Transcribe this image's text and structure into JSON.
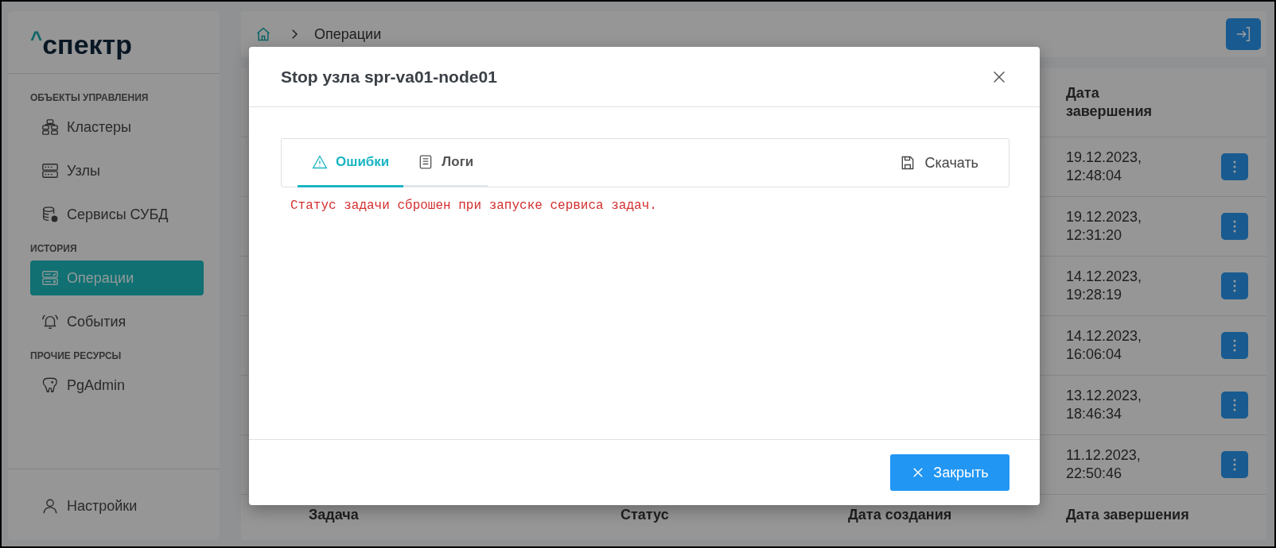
{
  "sidebar": {
    "logo": {
      "mark": "^",
      "name": "спектр"
    },
    "sections": [
      {
        "title": "ОБЪЕКТЫ УПРАВЛЕНИЯ",
        "items": [
          {
            "label": "Кластеры",
            "selected": false
          },
          {
            "label": "Узлы",
            "selected": false
          },
          {
            "label": "Сервисы СУБД",
            "selected": false
          }
        ]
      },
      {
        "title": "ИСТОРИЯ",
        "items": [
          {
            "label": "Операции",
            "selected": true
          },
          {
            "label": "События",
            "selected": false
          }
        ]
      },
      {
        "title": "ПРОЧИЕ РЕСУРСЫ",
        "items": [
          {
            "label": "PgAdmin",
            "selected": false
          }
        ]
      }
    ],
    "settings": {
      "label": "Настройки"
    }
  },
  "breadcrumb": {
    "current": "Операции"
  },
  "table": {
    "end_column": "Дата завершения",
    "rows": [
      {
        "end_date": "19.12.2023, 12:48:04"
      },
      {
        "end_date": "19.12.2023, 12:31:20"
      },
      {
        "end_date": "14.12.2023, 19:28:19"
      },
      {
        "end_date": "14.12.2023, 16:06:04"
      },
      {
        "end_date": "13.12.2023, 18:46:34"
      },
      {
        "end_date": "11.12.2023, 22:50:46"
      }
    ],
    "footer_columns": [
      "Задача",
      "Статус",
      "Дата создания",
      "Дата завершения"
    ]
  },
  "dialog": {
    "title": "Stop узла spr-va01-node01",
    "tabs": [
      {
        "label": "Ошибки",
        "selected": true
      },
      {
        "label": "Логи",
        "selected": false
      }
    ],
    "download": "Скачать",
    "error_text": "Статус задачи сброшен при запуске сервиса задач.",
    "close_button": "Закрыть"
  }
}
